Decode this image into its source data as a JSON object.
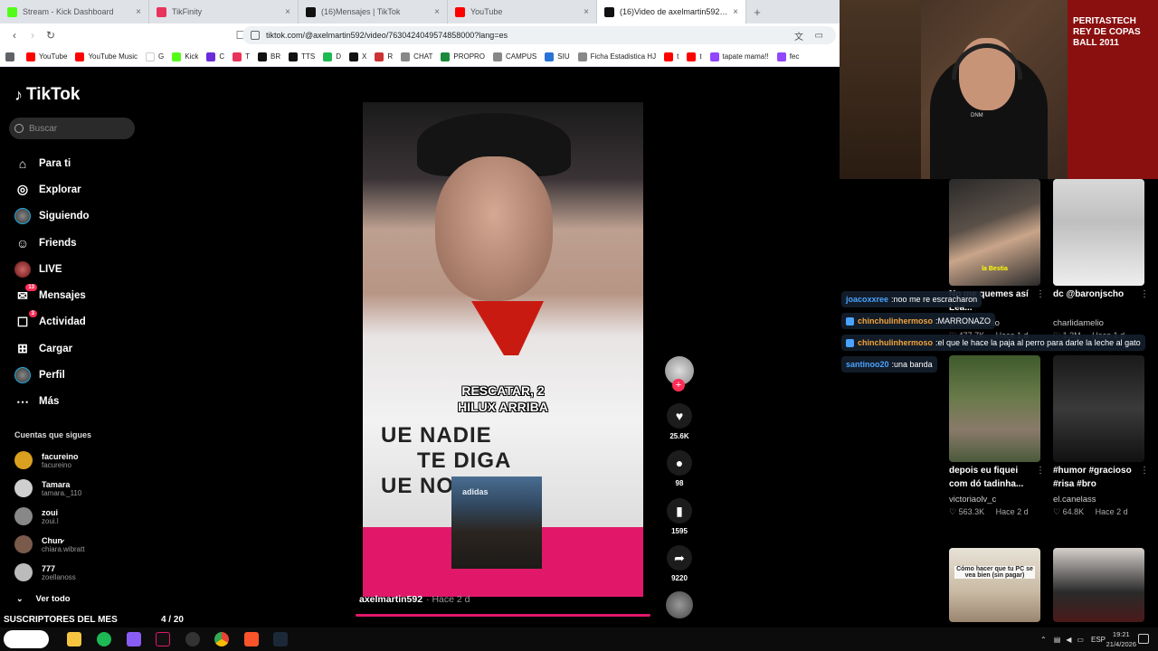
{
  "browser": {
    "tabs": [
      {
        "title": "Stream - Kick Dashboard",
        "icon": "kick-icon",
        "color": "#53fc18"
      },
      {
        "title": "TikFinity",
        "icon": "tikfinity-icon",
        "color": "#e8345a"
      },
      {
        "title": "(16)Mensajes | TikTok",
        "icon": "tiktok-icon",
        "color": "#111111"
      },
      {
        "title": "YouTube",
        "icon": "youtube-icon",
        "color": "#ff0000"
      },
      {
        "title": "(16)Video de axelmartin592 (@a",
        "icon": "tiktok-icon",
        "color": "#111111"
      }
    ],
    "url": "tiktok.com/@axelmartin592/video/7630424049574858000?lang=es",
    "bookmarks": [
      {
        "label": "",
        "color": "#5f6368"
      },
      {
        "label": "YouTube",
        "color": "#ff0000"
      },
      {
        "label": "YouTube Music",
        "color": "#ff0000"
      },
      {
        "label": "G",
        "color": "#ffffff"
      },
      {
        "label": "Kick",
        "color": "#53fc18"
      },
      {
        "label": "C",
        "color": "#6c2bd9"
      },
      {
        "label": "T",
        "color": "#e8345a"
      },
      {
        "label": "BR",
        "color": "#111111"
      },
      {
        "label": "TTS",
        "color": "#111111"
      },
      {
        "label": "D",
        "color": "#1db954"
      },
      {
        "label": "X",
        "color": "#111111"
      },
      {
        "label": "R",
        "color": "#c33"
      },
      {
        "label": "CHAT",
        "color": "#888888"
      },
      {
        "label": "PROPRO",
        "color": "#1a8a3a"
      },
      {
        "label": "CAMPUS",
        "color": "#888888"
      },
      {
        "label": "SIU",
        "color": "#2a73d6"
      },
      {
        "label": "Ficha Estadistica HJ",
        "color": "#888888"
      },
      {
        "label": "t",
        "color": "#ff0000"
      },
      {
        "label": "t",
        "color": "#ff0000"
      },
      {
        "label": "tapate mama!!",
        "color": "#9146ff"
      },
      {
        "label": "fec",
        "color": "#9146ff"
      }
    ]
  },
  "tiktok": {
    "logo": "TikTok",
    "search_placeholder": "Buscar",
    "nav": [
      {
        "label": "Para ti",
        "icon": "home-icon",
        "glyph": "⌂",
        "badge": ""
      },
      {
        "label": "Explorar",
        "icon": "compass-icon",
        "glyph": "◎",
        "badge": ""
      },
      {
        "label": "Siguiendo",
        "icon": "following-avatar-icon",
        "glyph": "●",
        "badge": ""
      },
      {
        "label": "Friends",
        "icon": "friends-icon",
        "glyph": "☺",
        "badge": ""
      },
      {
        "label": "LIVE",
        "icon": "live-icon",
        "glyph": "●",
        "badge": ""
      },
      {
        "label": "Mensajes",
        "icon": "inbox-icon",
        "glyph": "✉",
        "badge": "13"
      },
      {
        "label": "Actividad",
        "icon": "activity-icon",
        "glyph": "☐",
        "badge": "3"
      },
      {
        "label": "Cargar",
        "icon": "upload-icon",
        "glyph": "⊞",
        "badge": ""
      },
      {
        "label": "Perfil",
        "icon": "profile-avatar-icon",
        "glyph": "●",
        "badge": ""
      },
      {
        "label": "Más",
        "icon": "more-icon",
        "glyph": "⋯",
        "badge": ""
      }
    ],
    "following_header": "Cuentas que sigues",
    "following": [
      {
        "name": "facureino",
        "handle": "facureino",
        "color": "#d9a020"
      },
      {
        "name": "Tamara",
        "handle": "tamara._110",
        "color": "#cfcfcf"
      },
      {
        "name": "zoui",
        "handle": "zoui.l",
        "color": "#888888"
      },
      {
        "name": "Chun̷",
        "handle": "chiara.wibratt",
        "color": "#7a5a4a"
      },
      {
        "name": "777",
        "handle": "zoellanoss",
        "color": "#bbbbbb"
      }
    ],
    "ver_todo": "Ver todo",
    "video": {
      "caption_line1": "RESCATAR, 2",
      "caption_line2": "HILUX ARRIBA",
      "shirt_line1": "UE NADIE",
      "shirt_line2": "TE DIGA",
      "shirt_line3": "UE NO P",
      "inset_label": "adidas",
      "author": "axelmartin592",
      "ago": "· Hace 2 d"
    },
    "actions": {
      "likes": "25.6K",
      "comments": "98",
      "saves": "1595",
      "shares": "9220"
    }
  },
  "overlay": {
    "subs_label": "SUSCRIPTORES DEL MES",
    "subs_count": "4 / 20",
    "cam_flag_text": "PERITASTECH\nREY DE COPAS\nBALL 2011",
    "cam_shirt": "DNM"
  },
  "feed": [
    {
      "title": "No me quemes así Lea...",
      "user": "charlidamelio",
      "views": "477.7K",
      "ago": "Hace 1 d",
      "thumb_label": "la Bestia"
    },
    {
      "title": "dc @baronjscho",
      "user": "charlidamelio",
      "views": "1.3M",
      "ago": "Hace 1 d",
      "thumb_label": ""
    },
    {
      "title": "depois eu fiquei com dó tadinha...",
      "user": "victoriaolv_c",
      "views": "563.3K",
      "ago": "Hace 2 d",
      "thumb_label": ""
    },
    {
      "title": "#humor #gracioso #risa #bro",
      "user": "el.canelass",
      "views": "64.8K",
      "ago": "Hace 2 d",
      "thumb_label": ""
    },
    {
      "title": "",
      "user": "",
      "views": "",
      "ago": "",
      "thumb_label": "Cómo hacer que tu PC se vea bien (sin pagar)"
    },
    {
      "title": "",
      "user": "",
      "views": "",
      "ago": "",
      "thumb_label": ""
    }
  ],
  "chat": [
    {
      "user": "joacoxxree",
      "text": "noo me re escracharon",
      "color": "#4aa3ff",
      "badge": false
    },
    {
      "user": "chinchulinhermoso",
      "text": "MARRONAZO",
      "color": "#f3a33a",
      "badge": true
    },
    {
      "user": "chinchulinhermoso",
      "text": "el que le hace la paja al perro para darle la leche al gato",
      "color": "#f3a33a",
      "badge": true
    },
    {
      "user": "santinoo20",
      "text": "una banda",
      "color": "#4aa3ff",
      "badge": false
    }
  ],
  "taskbar": {
    "lang": "ESP",
    "time": "19:21",
    "date": "21/4/2026"
  }
}
